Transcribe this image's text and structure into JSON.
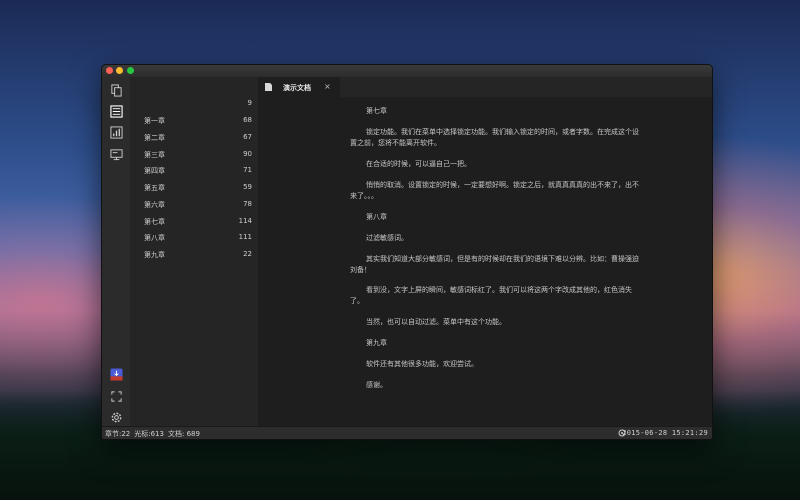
{
  "sidebar": {
    "items": [
      {
        "title": "",
        "count": "9"
      },
      {
        "title": "第一章",
        "count": "68"
      },
      {
        "title": "第二章",
        "count": "67"
      },
      {
        "title": "第三章",
        "count": "90"
      },
      {
        "title": "第四章",
        "count": "71"
      },
      {
        "title": "第五章",
        "count": "59"
      },
      {
        "title": "第六章",
        "count": "78"
      },
      {
        "title": "第七章",
        "count": "114"
      },
      {
        "title": "第八章",
        "count": "111"
      },
      {
        "title": "第九章",
        "count": "22"
      }
    ]
  },
  "activitybar": {
    "icons": [
      "files-icon",
      "outline-icon",
      "stats-icon",
      "preview-icon",
      "app-badge-icon",
      "fullscreen-icon",
      "gear-icon"
    ]
  },
  "tab": {
    "label": "演示文档",
    "close": "×"
  },
  "document": {
    "paragraphs": [
      "第七章",
      "锁定功能。我们在菜单中选择锁定功能。我们输入锁定的时间，或者字数。在完成这个设置之前，您将不能离开软件。",
      "在合适的时候，可以逼自己一把。",
      "悄悄的取消。设置锁定的时候，一定要想好啊。锁定之后，就真真真真的出不来了，出不来了。。。",
      "第八章",
      "过滤敏感词。",
      "其实我们知道大部分敏感词，但是有的时候却在我们的语境下难以分辨。比如：曹操强迫刘备！",
      "看到没，文字上屏的瞬间，敏感词标红了。我们可以将这两个字改成其他的，红色消失了。",
      "当然，也可以自动过滤。菜单中有这个功能。",
      "第九章",
      "软件还有其他很多功能，欢迎尝试。",
      "感谢。"
    ]
  },
  "status": {
    "chapter": "章节:22",
    "cursor": "光标:613",
    "doc": "文档: 689",
    "datetime": "2015-06-28 15:21:29"
  },
  "colors": {
    "accent_badge": "#4a5bd4"
  }
}
